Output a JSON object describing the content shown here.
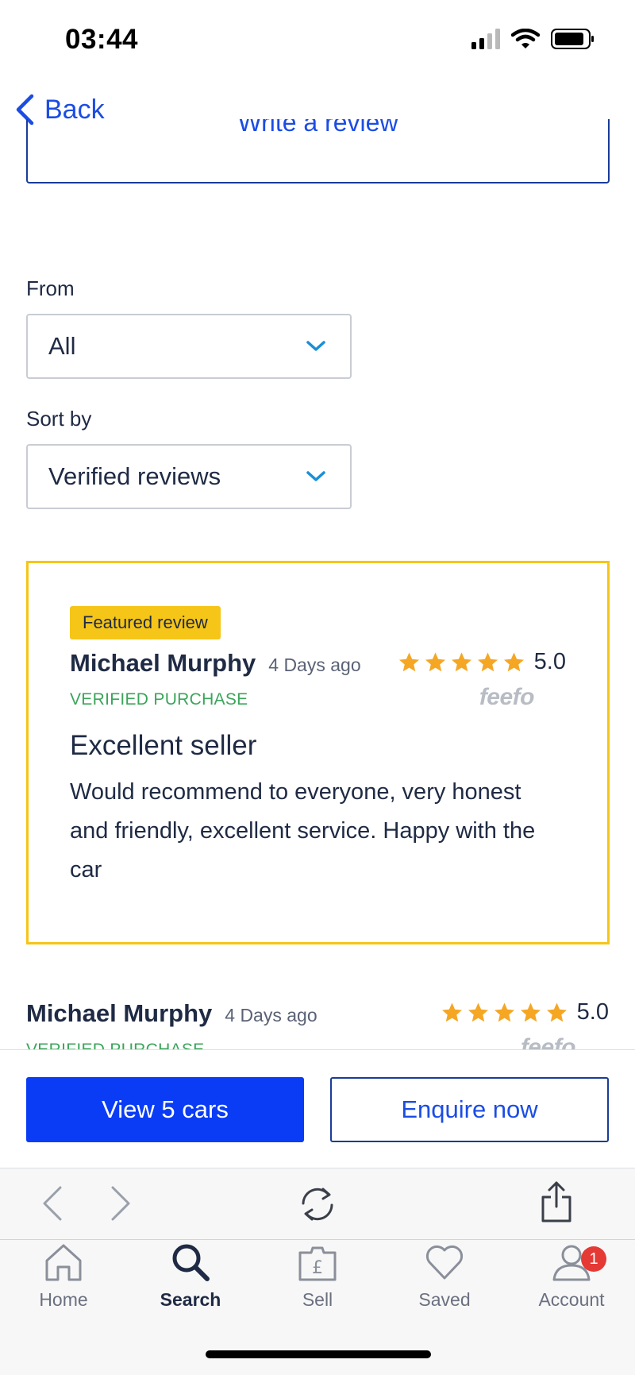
{
  "status_bar": {
    "time": "03:44"
  },
  "nav": {
    "back_label": "Back"
  },
  "write_review": {
    "label": "Write a review"
  },
  "filters": {
    "from_label": "From",
    "from_value": "All",
    "sort_label": "Sort by",
    "sort_value": "Verified reviews"
  },
  "featured_review": {
    "badge": "Featured review",
    "reviewer": "Michael Murphy",
    "date": "4 Days ago",
    "stars": 5,
    "rating": "5.0",
    "verified": "VERIFIED PURCHASE",
    "provider": "feefo",
    "title": "Excellent seller",
    "body": "Would recommend to everyone, very honest and friendly, excellent service. Happy with the car"
  },
  "second_review": {
    "reviewer": "Michael Murphy",
    "date": "4 Days ago",
    "stars": 5,
    "rating": "5.0",
    "verified": "VERIFIED PURCHASE",
    "provider": "feefo"
  },
  "actions": {
    "view_cars": "View 5 cars",
    "enquire": "Enquire now"
  },
  "tabs": [
    {
      "label": "Home"
    },
    {
      "label": "Search"
    },
    {
      "label": "Sell"
    },
    {
      "label": "Saved"
    },
    {
      "label": "Account",
      "badge": "1"
    }
  ],
  "colors": {
    "accent_blue": "#0a3cf5",
    "link_blue": "#1b4de4",
    "featured_yellow": "#f5c518",
    "star_orange": "#f5a623",
    "verified_green": "#3ba55a",
    "badge_red": "#e53935"
  }
}
